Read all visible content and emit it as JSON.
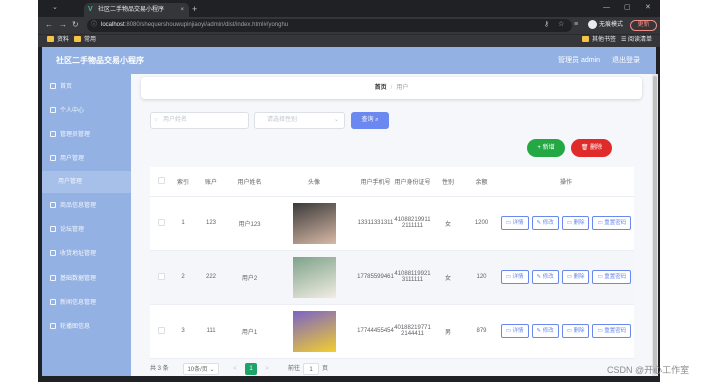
{
  "browser": {
    "tab_title": "社区二手物品交易小程序",
    "url_host": "localhost",
    "url_rest": ":8080/shequershouwupinjiaoyi/admin/dist/index.html#/yonghu",
    "incognito_label": "无痕模式",
    "update_label": "更新",
    "bookmarks": [
      "资料",
      "常用"
    ],
    "bookmarks_right": [
      "其他书签",
      "阅读清单"
    ]
  },
  "app": {
    "title": "社区二手物品交易小程序",
    "admin_label": "管理员 admin",
    "logout_label": "退出登录"
  },
  "sidebar": {
    "items": [
      {
        "label": "首页",
        "icon": "home-icon"
      },
      {
        "label": "个人中心",
        "icon": "user-icon"
      },
      {
        "label": "管理员管理",
        "icon": "admin-icon"
      },
      {
        "label": "用户管理",
        "icon": "users-icon"
      },
      {
        "label": "用户管理",
        "icon": "",
        "sub": true
      },
      {
        "label": "商品信息管理",
        "icon": "goods-icon"
      },
      {
        "label": "论坛管理",
        "icon": "forum-icon"
      },
      {
        "label": "收货地址管理",
        "icon": "address-icon"
      },
      {
        "label": "基础数据管理",
        "icon": "data-icon"
      },
      {
        "label": "新闻信息管理",
        "icon": "news-icon"
      },
      {
        "label": "轮播图信息",
        "icon": "carousel-icon"
      }
    ]
  },
  "breadcrumb": {
    "home": "首页",
    "separator": "/",
    "current": "用户"
  },
  "search": {
    "name_placeholder": "用户姓名",
    "gender_placeholder": "请选择性别",
    "search_label": "查询"
  },
  "actions": {
    "add_label": "+ 新增",
    "delete_label": "删除"
  },
  "table": {
    "headers": [
      "索引",
      "账户",
      "用户姓名",
      "头像",
      "用户手机号",
      "用户身份证号",
      "性别",
      "余额",
      "操作"
    ],
    "rows": [
      {
        "index": "1",
        "account": "123",
        "name": "用户123",
        "phone": "13311331311",
        "id_card": "410882199112111111",
        "gender": "女",
        "balance": "1200",
        "avatar_colors": [
          "#3a3a3a",
          "#d8b9a6"
        ]
      },
      {
        "index": "2",
        "account": "222",
        "name": "用户2",
        "phone": "17785599461",
        "id_card": "410881199213111111",
        "gender": "女",
        "balance": "120",
        "avatar_colors": [
          "#7ea28a",
          "#f2ede3"
        ]
      },
      {
        "index": "3",
        "account": "111",
        "name": "用户1",
        "phone": "17744455454",
        "id_card": "401882197712144411",
        "gender": "男",
        "balance": "879",
        "avatar_colors": [
          "#7b63c8",
          "#f2cf2e"
        ]
      }
    ],
    "op_labels": {
      "detail": "详情",
      "edit": "修改",
      "delete": "删除",
      "reset": "重置密码"
    }
  },
  "pagination": {
    "total": "共 3 条",
    "page_size": "10条/页",
    "prev": "<",
    "page": "1",
    "next": ">",
    "goto": "前往",
    "goto_value": "1",
    "goto_suffix": "页"
  },
  "watermark": "CSDN @开心工作室"
}
